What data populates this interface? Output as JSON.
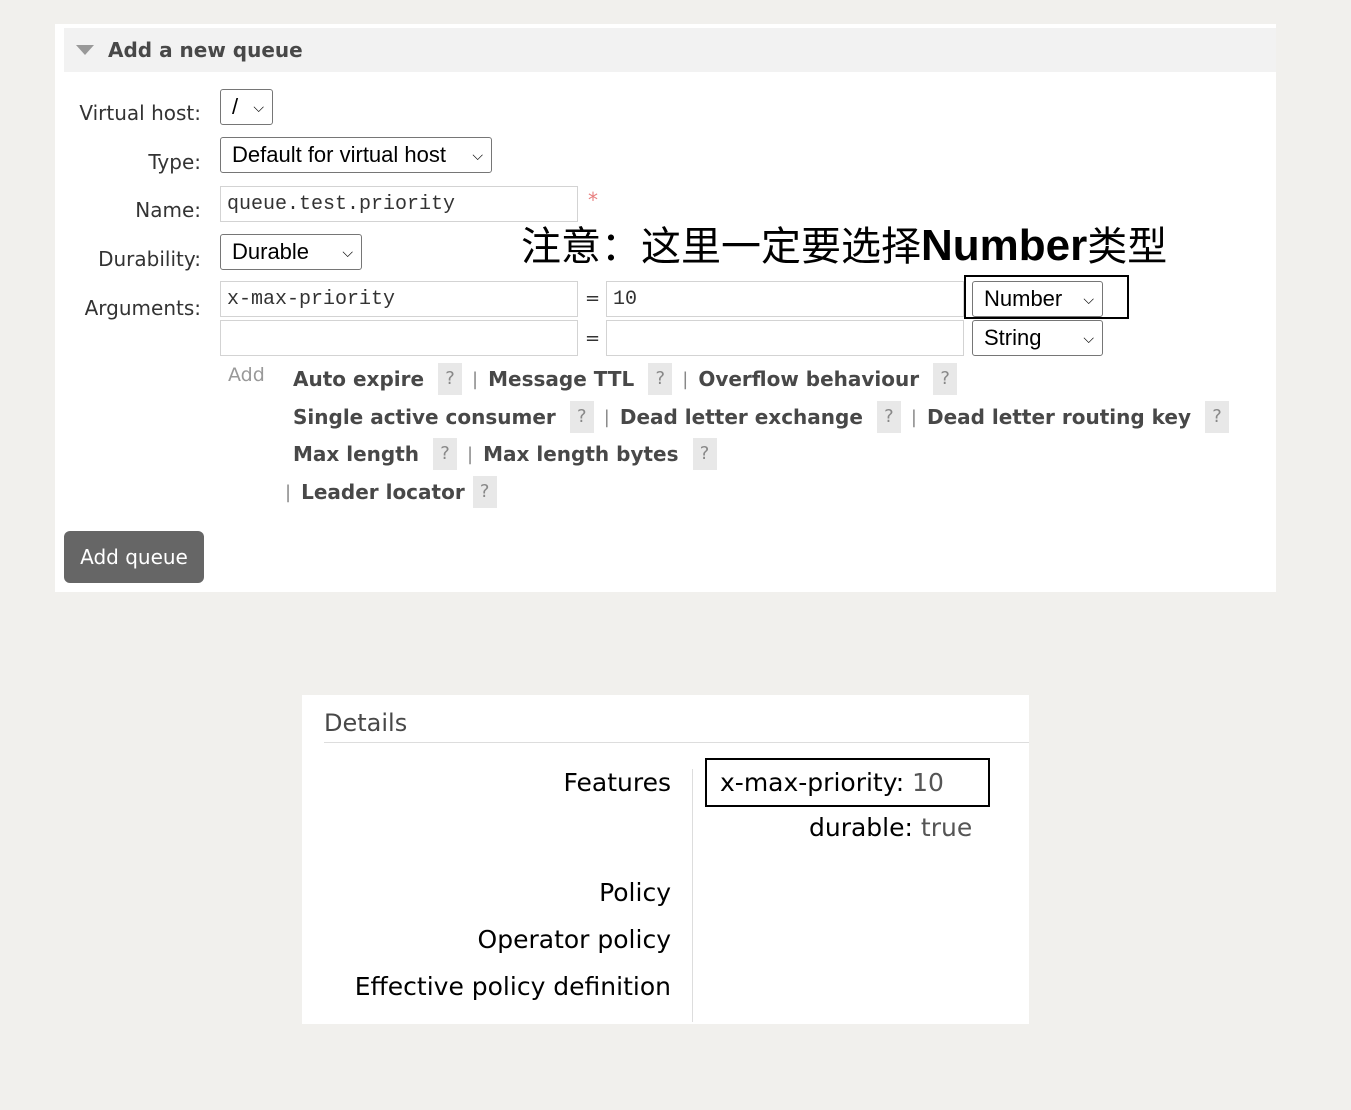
{
  "section": {
    "title": "Add a new queue"
  },
  "form": {
    "virtual_host": {
      "label": "Virtual host:",
      "value": "/"
    },
    "type": {
      "label": "Type:",
      "value": "Default for virtual host"
    },
    "name": {
      "label": "Name:",
      "value": "queue.test.priority",
      "required_mark": "*"
    },
    "durability": {
      "label": "Durability:",
      "value": "Durable"
    },
    "arguments": {
      "label": "Arguments:",
      "rows": [
        {
          "key": "x-max-priority",
          "eq": "=",
          "value": "10",
          "type": "Number"
        },
        {
          "key": "",
          "eq": "=",
          "value": "",
          "type": "String"
        }
      ],
      "add_label": "Add",
      "links": [
        "Auto expire",
        "Message TTL",
        "Overflow behaviour",
        "Single active consumer",
        "Dead letter exchange",
        "Dead letter routing key",
        "Max length",
        "Max length bytes",
        "Leader locator"
      ],
      "help": "?",
      "separator": "|"
    },
    "submit_label": "Add queue"
  },
  "annotation": {
    "prefix": "注意：这里一定要选择",
    "bold": "Number",
    "suffix": "类型"
  },
  "details": {
    "title": "Details",
    "labels": {
      "features": "Features",
      "policy": "Policy",
      "operator_policy": "Operator policy",
      "effective": "Effective policy definition"
    },
    "features": [
      {
        "key": "x-max-priority:",
        "value": "10"
      },
      {
        "key": "durable:",
        "value": "true"
      }
    ]
  }
}
